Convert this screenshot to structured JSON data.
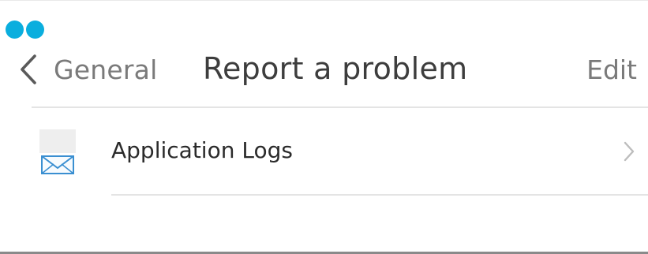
{
  "status_indicator": {
    "dot_color": "#0AAEDE",
    "dot_count": 2
  },
  "navbar": {
    "back_label": "General",
    "back_icon": "chevron-left-icon",
    "title": "Report a problem",
    "edit_label": "Edit"
  },
  "list": {
    "items": [
      {
        "label": "Application Logs",
        "icon": "mail-envelope-icon",
        "accessory_icon": "chevron-right-icon"
      }
    ]
  }
}
